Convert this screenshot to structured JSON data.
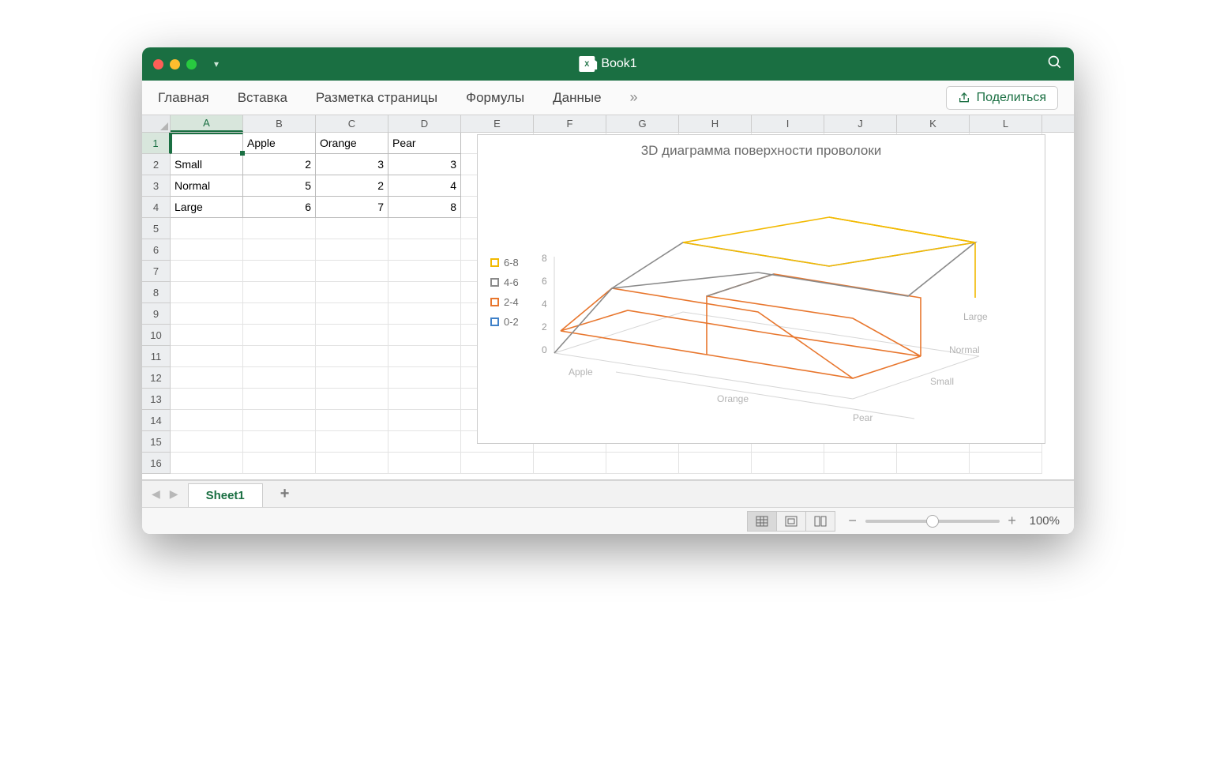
{
  "window": {
    "title": "Book1"
  },
  "ribbon": {
    "tabs": [
      "Главная",
      "Вставка",
      "Разметка страницы",
      "Формулы",
      "Данные"
    ],
    "share": "Поделиться"
  },
  "columns": [
    "A",
    "B",
    "C",
    "D",
    "E",
    "F",
    "G",
    "H",
    "I",
    "J",
    "K",
    "L"
  ],
  "row_count": 16,
  "active_cell": "A1",
  "cells": {
    "B1": "Apple",
    "C1": "Orange",
    "D1": "Pear",
    "A2": "Small",
    "B2": "2",
    "C2": "3",
    "D2": "3",
    "A3": "Normal",
    "B3": "5",
    "C3": "2",
    "D3": "4",
    "A4": "Large",
    "B4": "6",
    "C4": "7",
    "D4": "8"
  },
  "chart": {
    "title": "3D диаграмма поверхности проволоки",
    "legend": [
      {
        "label": "6-8",
        "color": "#f2b900"
      },
      {
        "label": "4-6",
        "color": "#8a8a8a"
      },
      {
        "label": "2-4",
        "color": "#e8762d"
      },
      {
        "label": "0-2",
        "color": "#3f81c9"
      }
    ],
    "z_ticks": [
      "8",
      "6",
      "4",
      "2",
      "0"
    ],
    "x_axis": [
      "Apple",
      "Orange",
      "Pear"
    ],
    "y_axis": [
      "Large",
      "Normal",
      "Small"
    ]
  },
  "chart_data": {
    "type": "surface-wireframe-3d",
    "title": "3D диаграмма поверхности проволоки",
    "x_categories": [
      "Apple",
      "Orange",
      "Pear"
    ],
    "y_categories": [
      "Small",
      "Normal",
      "Large"
    ],
    "z": [
      [
        2,
        3,
        3
      ],
      [
        5,
        2,
        4
      ],
      [
        6,
        7,
        8
      ]
    ],
    "zlim": [
      0,
      8
    ],
    "contour_bands": [
      {
        "range": [
          0,
          2
        ],
        "color": "#3f81c9"
      },
      {
        "range": [
          2,
          4
        ],
        "color": "#e8762d"
      },
      {
        "range": [
          4,
          6
        ],
        "color": "#8a8a8a"
      },
      {
        "range": [
          6,
          8
        ],
        "color": "#f2b900"
      }
    ]
  },
  "sheets": {
    "active": "Sheet1"
  },
  "status": {
    "zoom": "100%"
  }
}
